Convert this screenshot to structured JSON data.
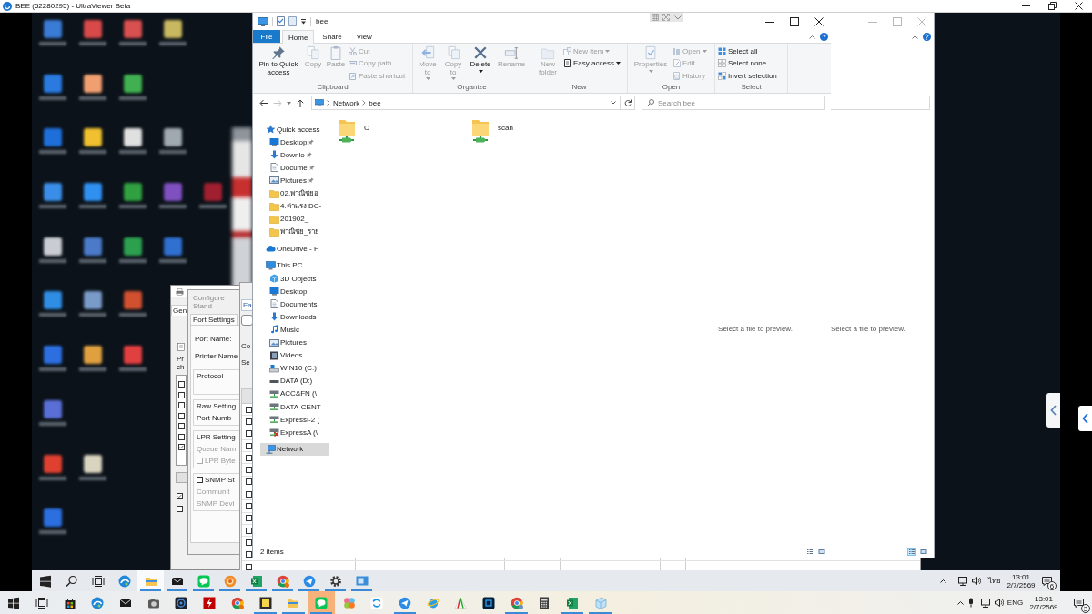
{
  "viewer": {
    "title": "BEE (52280295) - UltraViewer Beta"
  },
  "explorer": {
    "title": "bee",
    "ribbon_tabs": [
      {
        "label": "File",
        "kind": "file",
        "selected": false
      },
      {
        "label": "Home",
        "kind": "tab",
        "selected": true
      },
      {
        "label": "Share",
        "kind": "tab",
        "selected": false
      },
      {
        "label": "View",
        "kind": "tab",
        "selected": false
      }
    ],
    "ribbon_groups": [
      {
        "label": "Clipboard",
        "buttons": [
          {
            "label": "Pin to Quick access",
            "kind": "large",
            "disabled": false,
            "dropdown": false
          },
          {
            "label": "Copy",
            "kind": "large",
            "disabled": true,
            "dropdown": false
          },
          {
            "label": "Paste",
            "kind": "large",
            "disabled": true,
            "dropdown": false
          },
          {
            "label": "Cut",
            "kind": "small",
            "disabled": true,
            "dropdown": false
          },
          {
            "label": "Copy path",
            "kind": "small",
            "disabled": true,
            "dropdown": false
          },
          {
            "label": "Paste shortcut",
            "kind": "small",
            "disabled": true,
            "dropdown": false
          }
        ]
      },
      {
        "label": "Organize",
        "buttons": [
          {
            "label": "Move to",
            "kind": "large",
            "disabled": true,
            "dropdown": true
          },
          {
            "label": "Copy to",
            "kind": "large",
            "disabled": true,
            "dropdown": true
          },
          {
            "label": "Delete",
            "kind": "large",
            "disabled": false,
            "dropdown": true
          },
          {
            "label": "Rename",
            "kind": "large",
            "disabled": true,
            "dropdown": false
          }
        ]
      },
      {
        "label": "New",
        "buttons": [
          {
            "label": "New folder",
            "kind": "large",
            "disabled": true,
            "dropdown": false
          },
          {
            "label": "New item",
            "kind": "small",
            "disabled": true,
            "dropdown": true
          },
          {
            "label": "Easy access",
            "kind": "small",
            "disabled": false,
            "dropdown": true
          }
        ]
      },
      {
        "label": "Open",
        "buttons": [
          {
            "label": "Properties",
            "kind": "large",
            "disabled": true,
            "dropdown": true
          },
          {
            "label": "Open",
            "kind": "small",
            "disabled": true,
            "dropdown": true
          },
          {
            "label": "Edit",
            "kind": "small",
            "disabled": true,
            "dropdown": false
          },
          {
            "label": "History",
            "kind": "small",
            "disabled": true,
            "dropdown": false
          }
        ]
      },
      {
        "label": "Select",
        "buttons": [
          {
            "label": "Select all",
            "kind": "small",
            "disabled": false,
            "dropdown": false
          },
          {
            "label": "Select none",
            "kind": "small",
            "disabled": false,
            "dropdown": false
          },
          {
            "label": "Invert selection",
            "kind": "small",
            "disabled": false,
            "dropdown": false
          }
        ]
      }
    ],
    "address": [
      "Network",
      "bee"
    ],
    "search": {
      "placeholder": "Search bee"
    },
    "nav_pane": [
      {
        "label": "Quick access",
        "kind": "star",
        "selected": false,
        "children": [
          {
            "label": "Desktop",
            "kind": "desktop",
            "selected": false,
            "pinned": true
          },
          {
            "label": "Downlo",
            "kind": "downloads",
            "selected": false,
            "pinned": true
          },
          {
            "label": "Docume",
            "kind": "documents",
            "selected": false,
            "pinned": true
          },
          {
            "label": "Pictures",
            "kind": "pictures",
            "selected": false,
            "pinned": true
          },
          {
            "label": "02.พาณิชยอ",
            "kind": "folder",
            "selected": false,
            "pinned": false
          },
          {
            "label": "4.ค่าแรง DC-",
            "kind": "folder",
            "selected": false,
            "pinned": false
          },
          {
            "label": "201902_",
            "kind": "folder",
            "selected": false,
            "pinned": false
          },
          {
            "label": "พาณิชย_ราย",
            "kind": "folder",
            "selected": false,
            "pinned": false
          }
        ]
      },
      {
        "label": "OneDrive - P",
        "kind": "cloud",
        "selected": false
      },
      {
        "label": "This PC",
        "kind": "computer",
        "selected": false,
        "children": [
          {
            "label": "3D Objects",
            "kind": "objects",
            "selected": false,
            "disconnected": false
          },
          {
            "label": "Desktop",
            "kind": "desktop",
            "selected": false,
            "disconnected": false
          },
          {
            "label": "Documents",
            "kind": "documents",
            "selected": false,
            "disconnected": false
          },
          {
            "label": "Downloads",
            "kind": "downloads",
            "selected": false,
            "disconnected": false
          },
          {
            "label": "Music",
            "kind": "music",
            "selected": false,
            "disconnected": false
          },
          {
            "label": "Pictures",
            "kind": "pictures",
            "selected": false,
            "disconnected": false
          },
          {
            "label": "Videos",
            "kind": "videos",
            "selected": false,
            "disconnected": false
          },
          {
            "label": "WIN10 (C:)",
            "kind": "system",
            "selected": false,
            "disconnected": false
          },
          {
            "label": "DATA (D:)",
            "kind": "drive",
            "selected": false,
            "disconnected": false
          },
          {
            "label": "ACC&FN (\\",
            "kind": "netdrive",
            "selected": false,
            "disconnected": false
          },
          {
            "label": "DATA-CENT",
            "kind": "netdrive",
            "selected": false,
            "disconnected": false
          },
          {
            "label": "ExpressI-2 (",
            "kind": "netdrive",
            "selected": false,
            "disconnected": false
          },
          {
            "label": "ExpressA (\\",
            "kind": "netdrive",
            "selected": false,
            "disconnected": true
          }
        ]
      },
      {
        "label": "Network",
        "kind": "network",
        "selected": true
      }
    ],
    "items": [
      {
        "name": "C",
        "selected": false
      },
      {
        "name": "scan",
        "selected": false
      }
    ],
    "preview_text": "Select a file to preview.",
    "status_bar": {
      "count": "2 items",
      "views": [
        {
          "selected": false
        },
        {
          "selected": false
        }
      ]
    }
  },
  "back_window": {
    "preview_text": "Select a file to preview.",
    "views": [
      {
        "selected": true
      },
      {
        "selected": false
      }
    ]
  },
  "printer_dialog": {
    "tab": "Gen",
    "texts": [
      "Pr",
      "ch"
    ],
    "list": [
      {
        "checked": false
      },
      {
        "checked": false
      },
      {
        "checked": false
      },
      {
        "checked": false
      },
      {
        "checked": false
      },
      {
        "checked": false
      },
      {
        "checked": true
      }
    ],
    "options": [
      {
        "checked": true
      },
      {
        "checked": false
      }
    ]
  },
  "port_dialog": {
    "title": "Configure Stand",
    "tab": "Port Settings",
    "labels": [
      "Port Name:",
      "Printer Name"
    ],
    "groups": [
      {
        "label": "Protocol",
        "kind": "text"
      },
      {
        "label": "Raw Setting",
        "kind": "text",
        "rows": [
          {
            "label": "Port Numb",
            "kind": "text",
            "disabled": false
          }
        ]
      },
      {
        "label": "LPR Setting",
        "kind": "text",
        "rows": [
          {
            "label": "Queue Nam",
            "kind": "text",
            "disabled": true
          },
          {
            "label": "LPR Byte",
            "kind": "check",
            "checked": false,
            "disabled": true
          }
        ]
      },
      {
        "label": "SNMP St",
        "kind": "check",
        "checked": false,
        "rows": [
          {
            "label": "Communit",
            "kind": "text",
            "disabled": true
          },
          {
            "label": "SNMP Devi",
            "kind": "text",
            "disabled": true
          }
        ]
      }
    ]
  },
  "list_window": {
    "tab": "Ea",
    "labels": [
      "Co",
      "Se"
    ],
    "rows": [
      {
        "checked": false
      },
      {
        "checked": false
      },
      {
        "checked": false
      },
      {
        "checked": false
      },
      {
        "checked": false
      },
      {
        "checked": false
      },
      {
        "checked": false
      },
      {
        "checked": false
      },
      {
        "checked": false
      },
      {
        "checked": false
      },
      {
        "checked": false
      },
      {
        "checked": false
      },
      {
        "checked": false
      },
      {
        "checked": false
      }
    ]
  },
  "remote_taskbar": {
    "apps": [
      {
        "running": false,
        "selected": false
      },
      {
        "running": true,
        "selected": true
      },
      {
        "running": true,
        "selected": false
      },
      {
        "running": true,
        "selected": false
      },
      {
        "running": true,
        "selected": false
      },
      {
        "running": true,
        "selected": false
      },
      {
        "running": true,
        "selected": false
      },
      {
        "running": true,
        "selected": false
      },
      {
        "running": true,
        "selected": false
      },
      {
        "running": true,
        "selected": false
      }
    ],
    "language": "ไทย",
    "time": "13:01",
    "date": "2/7/2569",
    "notifications": "6"
  },
  "local_taskbar": {
    "apps": [
      {
        "running": false,
        "selected": false
      },
      {
        "running": false,
        "selected": false
      },
      {
        "running": false,
        "selected": false
      },
      {
        "running": false,
        "selected": false
      },
      {
        "running": false,
        "selected": false
      },
      {
        "running": false,
        "selected": false
      },
      {
        "running": false,
        "selected": false
      },
      {
        "running": true,
        "selected": false
      },
      {
        "running": true,
        "selected": false
      },
      {
        "running": true,
        "selected": true
      },
      {
        "running": false,
        "selected": false
      },
      {
        "running": false,
        "selected": false
      },
      {
        "running": true,
        "selected": false
      },
      {
        "running": false,
        "selected": false
      },
      {
        "running": false,
        "selected": false
      },
      {
        "running": false,
        "selected": false
      },
      {
        "running": true,
        "selected": false
      },
      {
        "running": false,
        "selected": false
      },
      {
        "running": true,
        "selected": false
      },
      {
        "running": true,
        "selected": false
      }
    ],
    "language": "ENG",
    "time": "13:01",
    "date": "2/7/2569",
    "notifications": "3"
  }
}
